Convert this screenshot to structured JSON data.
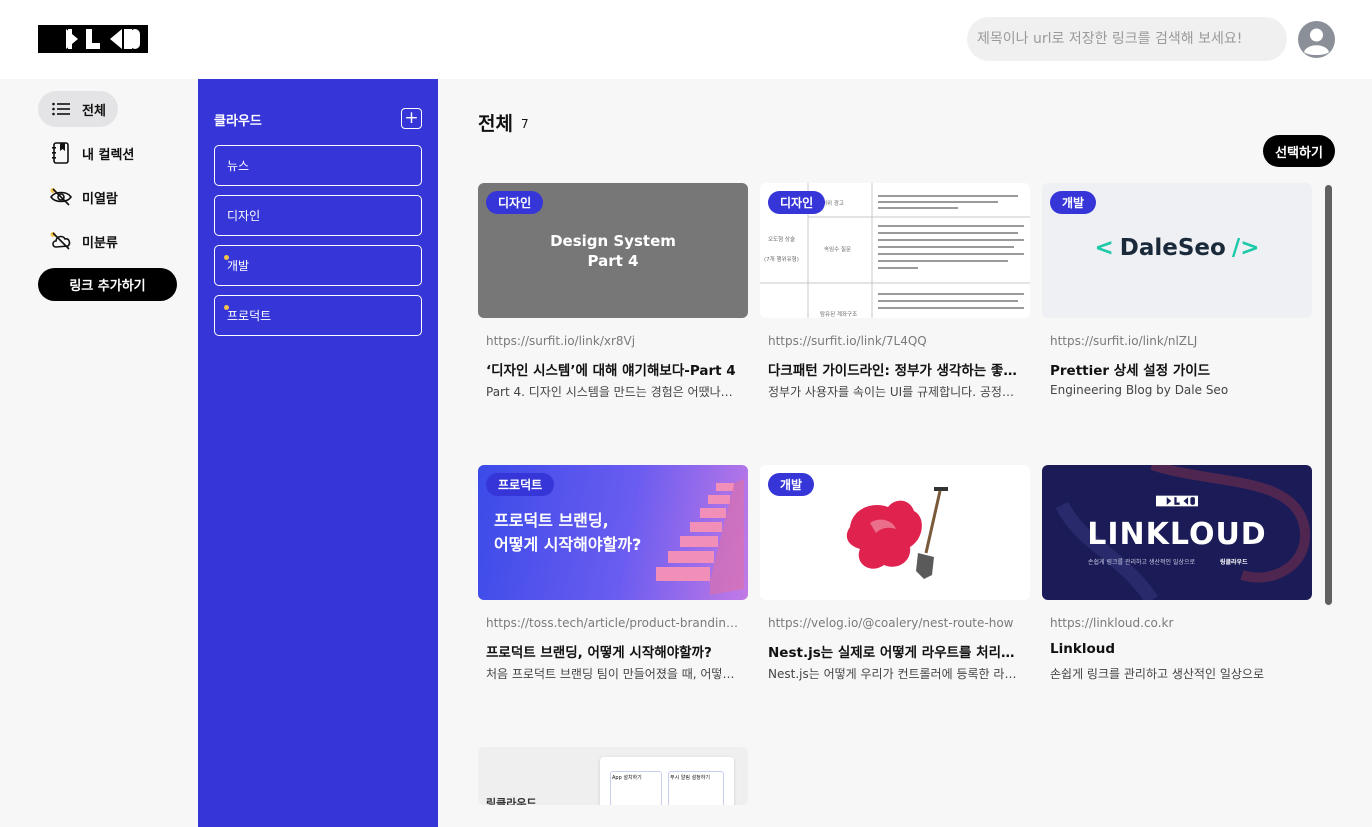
{
  "header": {
    "logo_text": "LKLD",
    "search_placeholder": "제목이나 url로 저장한 링크를 검색해 보세요!"
  },
  "nav": {
    "items": [
      {
        "label": "전체",
        "icon": "list-icon",
        "active": true
      },
      {
        "label": "내 컬렉션",
        "icon": "bookmark-book-icon"
      },
      {
        "label": "미열람",
        "icon": "eye-off-icon"
      },
      {
        "label": "미분류",
        "icon": "cloud-off-icon"
      }
    ],
    "add_link_label": "링크 추가하기"
  },
  "panel": {
    "title": "클라우드",
    "add_icon": "plus-icon",
    "collections": [
      {
        "label": "뉴스",
        "has_dot": false
      },
      {
        "label": "디자인",
        "has_dot": false
      },
      {
        "label": "개발",
        "has_dot": true
      },
      {
        "label": "프로덕트",
        "has_dot": true
      }
    ]
  },
  "main": {
    "title": "전체",
    "count": "7",
    "select_label": "선택하기"
  },
  "cards": [
    {
      "tag": "디자인",
      "url": "https://surfit.io/link/xr8Vj",
      "title": "‘디자인 시스템’에 대해 얘기해보다-Part 4",
      "desc": "Part 4. 디자인 시스템을 만드는 경험은 어땠나요? ...",
      "thumb_text": [
        "Design System",
        "Part 4"
      ]
    },
    {
      "tag": "디자인",
      "url": "https://surfit.io/link/7L4QQ",
      "title": "다크패턴 가이드라인: 정부가 생각하는 좋은 ...",
      "desc": "정부가 사용자를 속이는 UI를 규제합니다. 공정거래...",
      "thumb_text": [
        "허위 광고",
        "오도형 상술",
        "(7개 행위유형)",
        "속임수 질문",
        "탐유된 계좌구조"
      ]
    },
    {
      "tag": "개발",
      "url": "https://surfit.io/link/nlZLJ",
      "title": "Prettier 상세 설정 가이드",
      "desc": "Engineering Blog by Dale Seo",
      "thumb_text": [
        "DaleSeo"
      ]
    },
    {
      "tag": "프로덕트",
      "url": "https://toss.tech/article/product-branding-...",
      "title": "프로덕트 브랜딩, 어떻게 시작해야할까?",
      "desc": "처음 프로덕트 브랜딩 팀이 만들어졌을 때, 어떻게 ...",
      "thumb_text": [
        "프로덕트 브랜딩,",
        "어떻게 시작해야할까?"
      ]
    },
    {
      "tag": "개발",
      "url": "https://velog.io/@coalery/nest-route-how",
      "title": "Nest.js는 실제로 어떻게 라우트를 처리할까?",
      "desc": "Nest.js는 어떻게 우리가 컨트롤러에 등록한 라우트...",
      "thumb_text": []
    },
    {
      "tag": "",
      "url": "https://linkloud.co.kr",
      "title": "Linkloud",
      "desc": "손쉽게 링크를 관리하고 생산적인 일상으로",
      "thumb_text": [
        "LINKLOUD",
        "손쉽게 링크를 관리하고 생산적인 일상으로",
        "링클라우드"
      ]
    },
    {
      "tag": "",
      "url": "",
      "title": "",
      "desc": "",
      "thumb_text": [
        "링클라우드",
        "App 설치하기",
        "푸시 알림 설정하기"
      ]
    }
  ]
}
